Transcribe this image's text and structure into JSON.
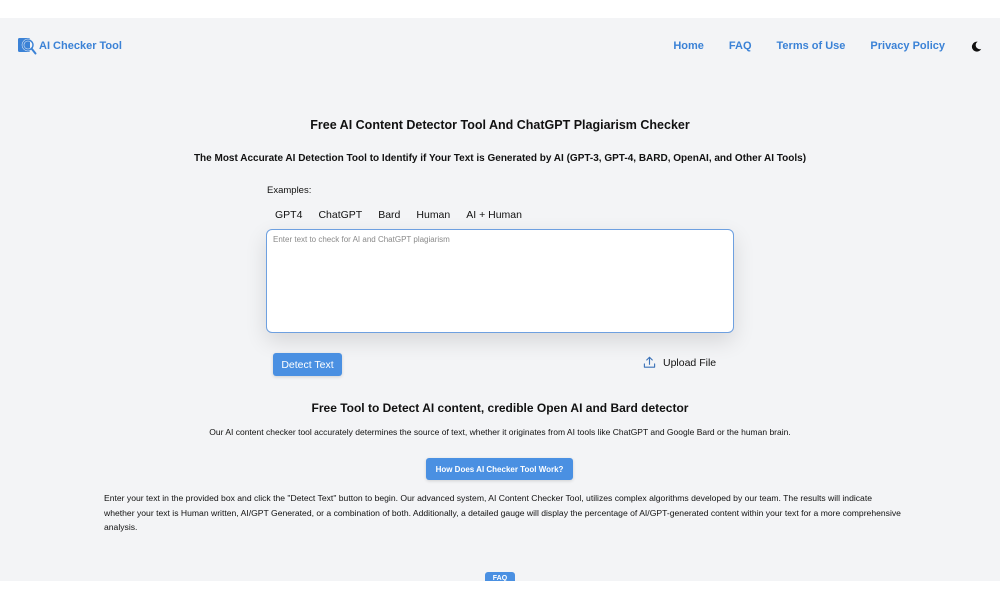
{
  "header": {
    "logo_text": "AI Checker Tool",
    "nav": [
      "Home",
      "FAQ",
      "Terms of Use",
      "Privacy Policy"
    ],
    "theme_toggle_icon": "moon-icon"
  },
  "main": {
    "title": "Free AI Content Detector Tool And ChatGPT Plagiarism Checker",
    "subtitle": "The Most Accurate AI Detection Tool to Identify if Your Text is Generated by AI (GPT-3, GPT-4, BARD, OpenAI, and Other AI Tools)",
    "examples_label": "Examples:",
    "examples": [
      "GPT4",
      "ChatGPT",
      "Bard",
      "Human",
      "AI + Human"
    ],
    "textarea_placeholder": "Enter text to check for AI and ChatGPT plagiarism",
    "textarea_value": "",
    "detect_button": "Detect Text",
    "upload_label": "Upload File",
    "upload_icon": "upload-icon"
  },
  "info": {
    "title": "Free Tool to Detect AI content, credible Open AI and Bard detector",
    "description": "Our AI content checker tool accurately determines the source of text, whether it originates from AI tools like ChatGPT and Google Bard or the human brain.",
    "how_button": "How Does AI Checker Tool Work?",
    "explanation": "Enter your text in the provided box and click the \"Detect Text\" button to begin. Our advanced system, AI Content Checker Tool, utilizes complex algorithms developed by our team. The results will indicate whether your text is Human written, AI/GPT Generated, or a combination of both. Additionally, a detailed gauge will display the percentage of AI/GPT-generated content within your text for a more comprehensive analysis.",
    "faq_button": "FAQ"
  },
  "colors": {
    "accent": "#3b82d6",
    "button": "#4a90e2",
    "background": "#f3f4f6"
  }
}
